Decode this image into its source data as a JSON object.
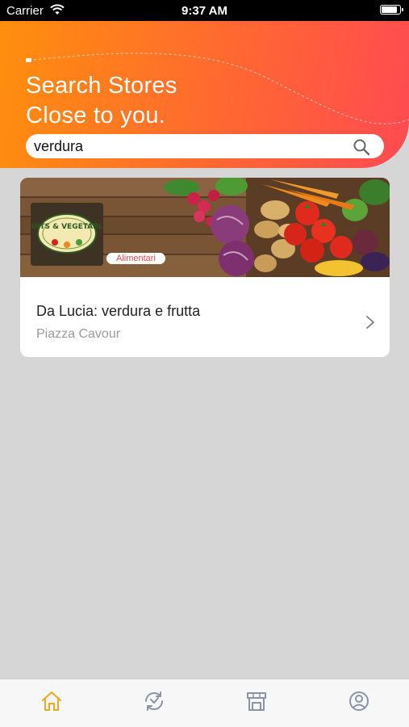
{
  "status_bar": {
    "carrier": "Carrier",
    "time": "9:37 AM"
  },
  "header": {
    "title": "Search Stores\nClose to you."
  },
  "search": {
    "value": "verdura",
    "icon": "search-icon"
  },
  "store_card": {
    "logo_text": "FRUITS & VEGETABLES",
    "category": "Alimentari",
    "name": "Da Lucia: verdura e frutta",
    "address": "Piazza Cavour"
  },
  "tab_bar": {
    "items": [
      {
        "icon": "home-icon",
        "active": true
      },
      {
        "icon": "orders-icon",
        "active": false
      },
      {
        "icon": "stores-icon",
        "active": false
      },
      {
        "icon": "profile-icon",
        "active": false
      }
    ]
  },
  "colors": {
    "gradient_start": "#ff8f0d",
    "gradient_end": "#ff4a52",
    "tab_active": "#f2a81d",
    "tab_inactive": "#8a93a6",
    "category_text": "#e54848",
    "background": "#d6d6d6"
  }
}
